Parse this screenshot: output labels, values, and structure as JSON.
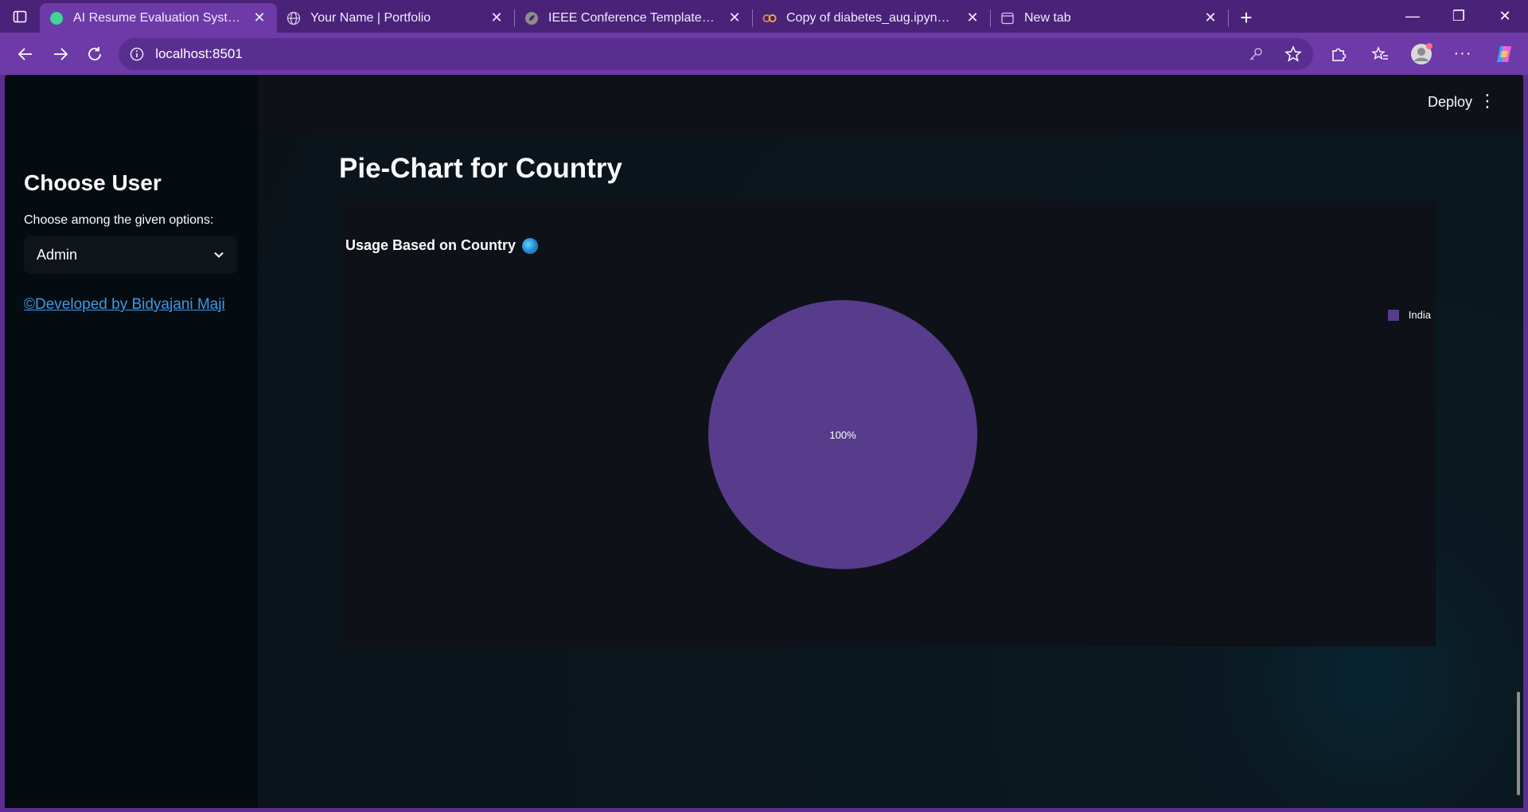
{
  "browser": {
    "tabs": [
      {
        "title": "AI Resume Evaluation System",
        "active": true,
        "icon": "streamlit-circle-icon"
      },
      {
        "title": "Your Name | Portfolio",
        "active": false,
        "icon": "globe-icon"
      },
      {
        "title": "IEEE Conference Template - Online",
        "active": false,
        "icon": "overleaf-icon"
      },
      {
        "title": "Copy of diabetes_aug.ipynb - Colab",
        "active": false,
        "icon": "colab-icon"
      },
      {
        "title": "New tab",
        "active": false,
        "icon": "newtab-icon"
      }
    ],
    "url": "localhost:8501"
  },
  "app": {
    "header": {
      "deploy_label": "Deploy"
    },
    "sidebar": {
      "title": "Choose User",
      "select_label": "Choose among the given options:",
      "select_value": "Admin",
      "developer_link": "©Developed by Bidyajani Maji"
    },
    "main": {
      "page_title": "Pie-Chart for Country",
      "chart_title": "Usage Based on Country",
      "chart_title_icon": "globe-emoji-icon"
    }
  },
  "colors": {
    "slice": "#573c8c",
    "link": "#3d9ae8"
  },
  "chart_data": {
    "type": "pie",
    "title": "Usage Based on Country",
    "categories": [
      "India"
    ],
    "values": [
      100
    ],
    "labels": [
      "100%"
    ],
    "legend": "top-right"
  }
}
